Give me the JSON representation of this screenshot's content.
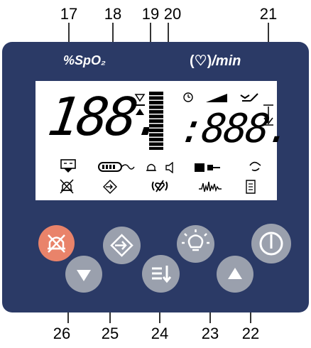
{
  "callouts_top": [
    "17",
    "18",
    "19",
    "20",
    "21"
  ],
  "callouts_bottom": [
    "26",
    "25",
    "24",
    "23",
    "22"
  ],
  "panel": {
    "spo2_label": "%SpO₂",
    "pulse_unit": "/min"
  },
  "lcd": {
    "spo2_digits": "188.",
    "pulse_digits": ":888."
  },
  "buttons": [
    {
      "name": "alarm-mute-button",
      "icon": "bell-crossed-icon",
      "color": "#e9836a"
    },
    {
      "name": "down-button",
      "icon": "triangle-down-icon",
      "color": "#9aa0ad"
    },
    {
      "name": "enter-button",
      "icon": "enter-arrow-icon",
      "color": "#9aa0ad"
    },
    {
      "name": "menu-button",
      "icon": "menu-arrow-icon",
      "color": "#9aa0ad"
    },
    {
      "name": "backlight-button",
      "icon": "light-icon",
      "color": "#9aa0ad"
    },
    {
      "name": "up-button",
      "icon": "triangle-up-icon",
      "color": "#9aa0ad"
    },
    {
      "name": "power-button",
      "icon": "power-icon",
      "color": "#9aa0ad"
    }
  ]
}
